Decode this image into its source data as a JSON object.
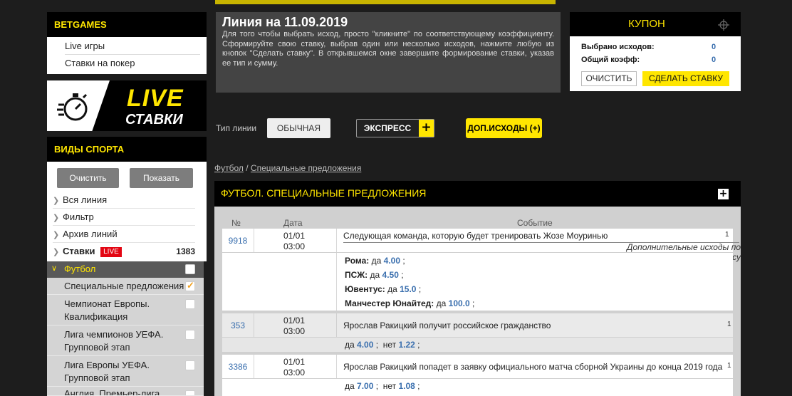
{
  "left": {
    "betgames": {
      "title": "BETGAMES",
      "items": [
        "Live игры",
        "Ставки на покер"
      ]
    },
    "live_banner": {
      "line1": "LIVE",
      "line2": "СТАВКИ"
    },
    "sports": {
      "title": "ВИДЫ СПОРТА",
      "clear_label": "Очистить",
      "show_label": "Показать",
      "items": [
        {
          "label": "Вся линия"
        },
        {
          "label": "Фильтр"
        },
        {
          "label": "Архив линий"
        },
        {
          "label": "Ставки",
          "badge": "LIVE",
          "count": "1383"
        }
      ],
      "football": "Футбол",
      "sub_items": [
        {
          "label": "Специальные предложения"
        },
        {
          "label": "Чемпионат Европы. Квалификация"
        },
        {
          "label": "Лига чемпионов УЕФА. Групповой этап"
        },
        {
          "label": "Лига Европы УЕФА. Групповой этап"
        },
        {
          "label": "Англия. Премьер-лига"
        }
      ]
    }
  },
  "info": {
    "title": "Линия на 11.09.2019",
    "text": "Для того чтобы выбрать исход, просто \"кликните\" по соответствующему коэффициенту. Сформируйте свою ставку, выбрав один или несколько исходов, нажмите любую из кнопок \"Сделать ставку\". В открывшемся окне завершите формирование ставки, указав ее тип и сумму."
  },
  "coupon": {
    "title": "КУПОН",
    "selected_label": "Выбрано исходов:",
    "selected_value": "0",
    "total_label": "Общий коэфф:",
    "total_value": "0",
    "clear_label": "ОЧИСТИТЬ",
    "bet_label": "СДЕЛАТЬ СТАВКУ"
  },
  "line_type": {
    "label": "Тип линии",
    "ordinary": "ОБЫЧНАЯ",
    "express": "ЭКСПРЕСС",
    "express_plus": "+",
    "extra": "ДОП.ИСХОДЫ (+)"
  },
  "breadcrumb": {
    "part1": "Футбол",
    "sep": " / ",
    "part2": "Специальные предложения"
  },
  "section": {
    "title": "ФУТБОЛ. СПЕЦИАЛЬНЫЕ ПРЕДЛОЖЕНИЯ",
    "toggle": "+"
  },
  "table": {
    "headers": {
      "num": "№",
      "date": "Дата",
      "event": "Событие"
    },
    "rows": [
      {
        "num": "9918",
        "date": "01/01",
        "time": "03:00",
        "event": "Следующая команда, которую будет тренировать Жозе Моуринью",
        "side": "1",
        "extra": "Дополнительные исходы по запросу",
        "options": [
          {
            "team": "Рома:",
            "label": "да",
            "odd": "4.00"
          },
          {
            "team": "ПСЖ:",
            "label": "да",
            "odd": "4.50"
          },
          {
            "team": "Ювентус:",
            "label": "да",
            "odd": "15.0"
          },
          {
            "team": "Манчестер Юнайтед:",
            "label": "да",
            "odd": "100.0"
          }
        ]
      },
      {
        "num": "353",
        "date": "01/01",
        "time": "03:00",
        "event": "Ярослав Ракицкий получит российское гражданство",
        "side": "1",
        "yes_label": "да",
        "yes": "4.00",
        "no_label": "нет",
        "no": "1.22"
      },
      {
        "num": "3386",
        "date": "01/01",
        "time": "03:00",
        "event": "Ярослав Ракицкий попадет в заявку официального матча сборной Украины до конца 2019 года",
        "side": "1",
        "yes_label": "да",
        "yes": "7.00",
        "no_label": "нет",
        "no": "1.08"
      }
    ]
  },
  "colors": {
    "accent": "#ffe600",
    "link": "#3a6fae",
    "dark": "#1d1d1d",
    "live_badge": "#e30613"
  }
}
